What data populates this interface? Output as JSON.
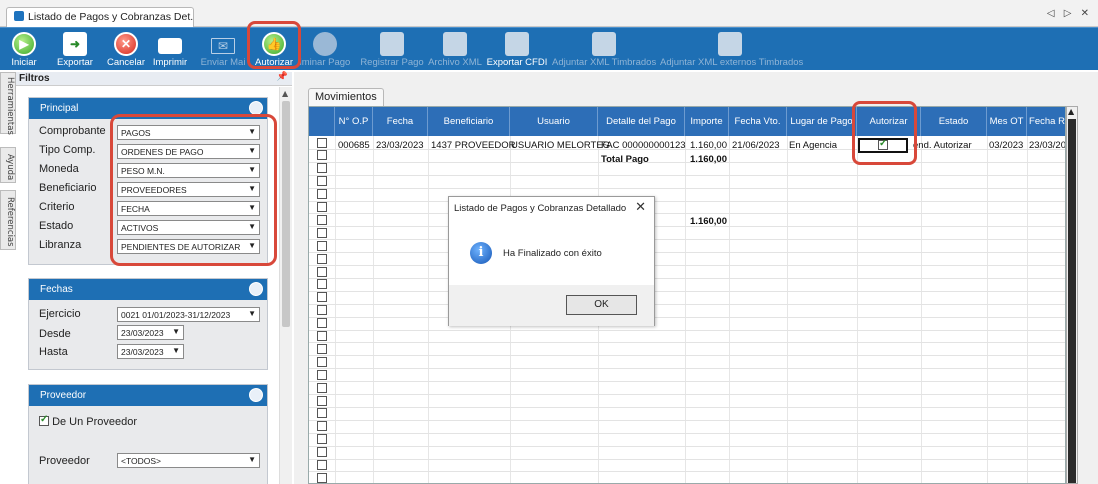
{
  "window": {
    "tab_title": "Listado de Pagos y Cobranzas Det...",
    "controls": "◁ ▷ ✕"
  },
  "ribbon": {
    "buttons": [
      {
        "label": "Iniciar",
        "icon": "play-icon"
      },
      {
        "label": "Exportar",
        "icon": "export-icon"
      },
      {
        "label": "Cancelar",
        "icon": "cancel-icon"
      },
      {
        "label": "Imprimir",
        "icon": "printer-icon"
      },
      {
        "label": "Enviar Mai",
        "icon": "mail-icon"
      },
      {
        "label": "Autorizar",
        "icon": "thumbs-up-icon"
      },
      {
        "label": "iminar Pago",
        "icon": "delete-payment-icon"
      },
      {
        "label": "Registrar Pago",
        "icon": "save-icon"
      },
      {
        "label": "Archivo XML",
        "icon": "xml-file-icon"
      },
      {
        "label": "Exportar CFDI",
        "icon": "cfdi-icon"
      },
      {
        "label": "Adjuntar XML Timbrados",
        "icon": "attach-xml-icon"
      },
      {
        "label": "Adjuntar XML externos Timbrados",
        "icon": "attach-external-xml-icon"
      }
    ]
  },
  "side_tabs": [
    "Herramientas",
    "Ayuda",
    "Referencias"
  ],
  "filters": {
    "title": "Filtros",
    "pin": "📌",
    "principal": {
      "title": "Principal",
      "fields": [
        {
          "label": "Comprobante",
          "value": "PAGOS"
        },
        {
          "label": "Tipo Comp.",
          "value": "ORDENES DE PAGO"
        },
        {
          "label": "Moneda",
          "value": "PESO M.N."
        },
        {
          "label": "Beneficiario",
          "value": "PROVEEDORES"
        },
        {
          "label": "Criterio",
          "value": "FECHA"
        },
        {
          "label": "Estado",
          "value": "ACTIVOS"
        },
        {
          "label": "Libranza",
          "value": "PENDIENTES DE AUTORIZAR"
        }
      ]
    },
    "fechas": {
      "title": "Fechas",
      "ejercicio_label": "Ejercicio",
      "ejercicio_value": "0021 01/01/2023-31/12/2023",
      "desde_label": "Desde",
      "desde_value": "23/03/2023",
      "hasta_label": "Hasta",
      "hasta_value": "23/03/2023"
    },
    "proveedor": {
      "title": "Proveedor",
      "de_un_proveedor": "De Un Proveedor",
      "proveedor_label": "Proveedor",
      "proveedor_value": "<TODOS>"
    }
  },
  "movimientos": {
    "tab": "Movimientos",
    "columns": [
      "N° O.P",
      "Fecha",
      "Beneficiario",
      "Usuario",
      "Detalle del Pago",
      "Importe",
      "Fecha Vto.",
      "Lugar de Pago",
      "Autorizar",
      "Estado",
      "Mes OT",
      "Fecha R"
    ],
    "row1": {
      "op": "000685",
      "fecha": "23/03/2023",
      "beneficiario": "1437 PROVEEDOR",
      "usuario": "USUARIO MELORTEG",
      "detalle": "FAC 000000000123",
      "importe": "1.160,00",
      "fecha_vto": "21/06/2023",
      "lugar": "En Agencia",
      "estado": "end. Autorizar",
      "mes_ot": "03/2023",
      "fecha_r": "23/03/20"
    },
    "total_label": "Total Pago",
    "total_value": "1.160,00",
    "grand_total": "1.160,00"
  },
  "dialog": {
    "title": "Listado de Pagos y Cobranzas Detallado",
    "message": "Ha Finalizado con éxito",
    "ok": "OK",
    "close": "✕"
  }
}
